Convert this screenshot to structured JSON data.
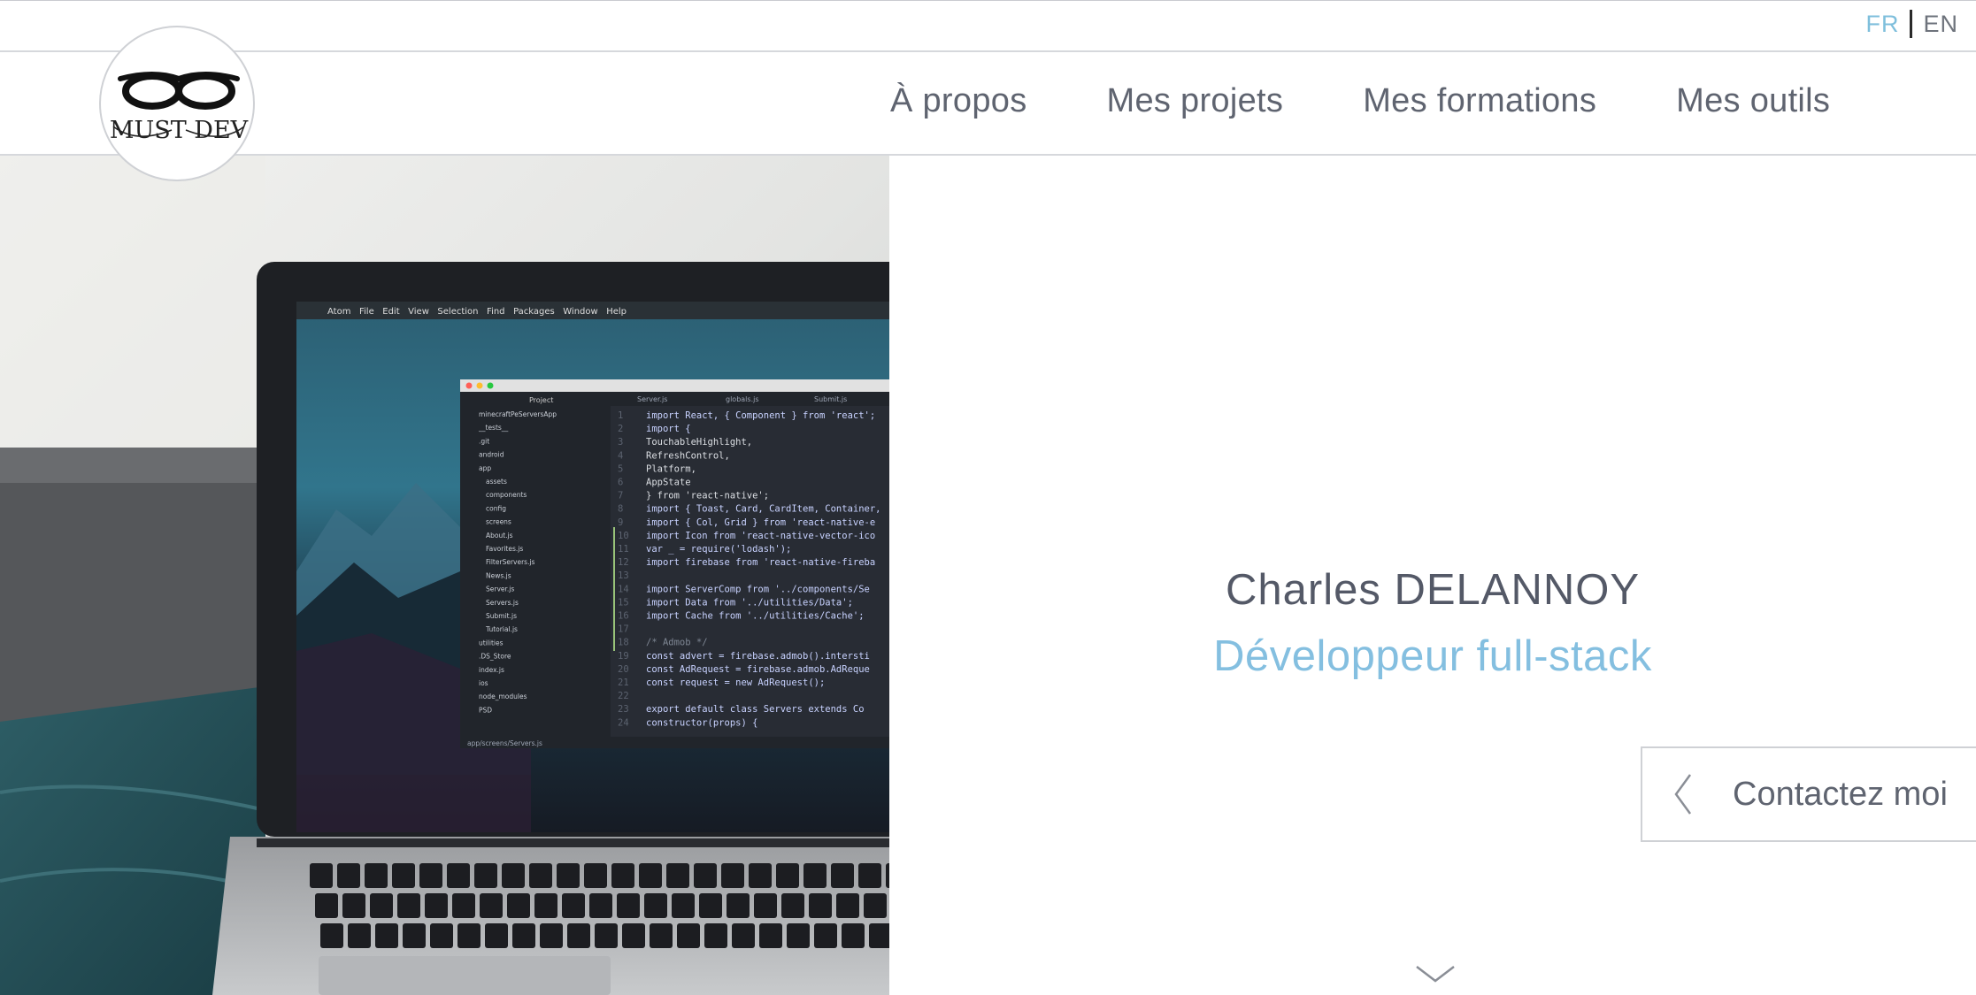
{
  "language_switcher": {
    "fr": "FR",
    "en": "EN",
    "active": "FR",
    "active_color": "#7fbfdc"
  },
  "logo": {
    "text": "MUST DEV",
    "icon": "glasses-icon"
  },
  "nav": {
    "items": [
      {
        "label": "À propos"
      },
      {
        "label": "Mes projets"
      },
      {
        "label": "Mes formations"
      },
      {
        "label": "Mes outils"
      }
    ]
  },
  "hero": {
    "name": "Charles DELANNOY",
    "role": "Développeur full-stack",
    "role_color": "#84bfe0",
    "contact_label": "Contactez moi",
    "contact_icon": "chevron-left-icon",
    "scroll_icon": "chevron-down-icon"
  },
  "photo": {
    "description_icon": "laptop-code-photo",
    "menubar": [
      "Atom",
      "File",
      "Edit",
      "View",
      "Selection",
      "Find",
      "Packages",
      "Window",
      "Help"
    ],
    "tree_title": "Project",
    "tabs": [
      "Server.js",
      "globals.js",
      "Submit.js"
    ],
    "files": [
      "minecraftPeServersApp",
      "__tests__",
      ".git",
      "android",
      "app",
      "assets",
      "components",
      "config",
      "screens",
      "About.js",
      "Favorites.js",
      "FilterServers.js",
      "News.js",
      "Server.js",
      "Servers.js",
      "Submit.js",
      "Tutorial.js",
      "utilities",
      ".DS_Store",
      "index.js",
      "ios",
      "node_modules",
      "PSD"
    ],
    "code_lines": [
      "import React, { Component } from 'react';",
      "import {",
      "  TouchableHighlight,",
      "  RefreshControl,",
      "  Platform,",
      "  AppState",
      "} from 'react-native';",
      "import { Toast, Card, CardItem, Container,",
      "import { Col, Grid } from 'react-native-e",
      "import Icon from 'react-native-vector-ico",
      "var _ = require('lodash');",
      "import firebase from 'react-native-fireba",
      "",
      "import ServerComp from '../components/Se",
      "import Data from '../utilities/Data';",
      "import Cache from '../utilities/Cache';",
      "",
      "/* Admob */",
      "const advert = firebase.admob().intersti",
      "const AdRequest = firebase.admob.AdReque",
      "const request = new AdRequest();",
      "",
      "export default class Servers extends Co",
      "  constructor(props) {"
    ],
    "status_path": "app/screens/Servers.js"
  }
}
